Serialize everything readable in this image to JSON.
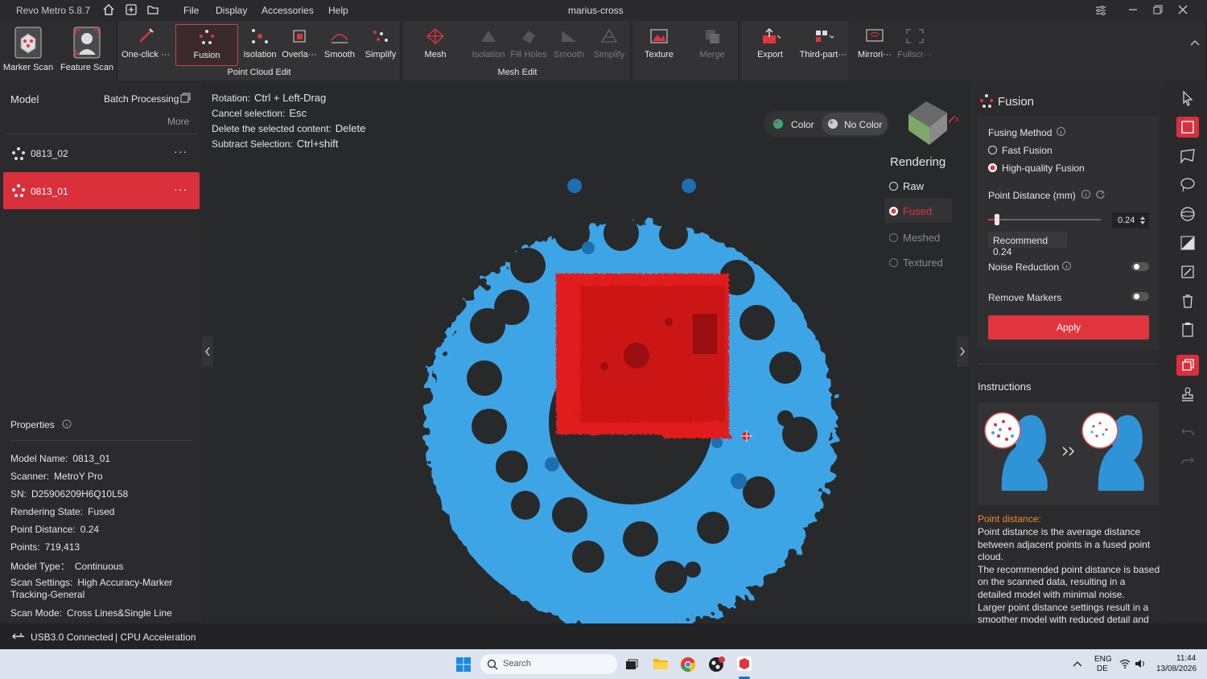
{
  "titlebar": {
    "app": "Revo Metro 5.8.7",
    "menu": [
      "File",
      "Display",
      "Accessories",
      "Help"
    ],
    "project": "marius-cross"
  },
  "ribbon": {
    "scan": [
      "Marker Scan",
      "Feature Scan"
    ],
    "point_cloud": [
      "One-click ···",
      "Fusion",
      "Isolation",
      "Overla···",
      "Smooth",
      "Simplify"
    ],
    "point_cloud_label": "Point Cloud Edit",
    "mesh": [
      "Mesh",
      "Isolation",
      "Fill Holes",
      "Smooth",
      "Simplify"
    ],
    "mesh_label": "Mesh Edit",
    "texture": "Texture",
    "merge": "Merge",
    "export": "Export",
    "thirdparty": "Third-part···",
    "mirror": "Mirrori···",
    "fullscreen": "Fullscr···"
  },
  "left": {
    "title": "Model",
    "batch": "Batch Processing",
    "more": "More",
    "models": [
      "0813_02",
      "0813_01"
    ],
    "properties_title": "Properties",
    "properties": [
      {
        "k": "Model Name:",
        "v": "0813_01"
      },
      {
        "k": "Scanner:",
        "v": "MetroY Pro"
      },
      {
        "k": "SN:",
        "v": "D25906209H6Q10L58"
      },
      {
        "k": "Rendering State:",
        "v": "Fused"
      },
      {
        "k": "Point Distance:",
        "v": "0.24"
      },
      {
        "k": "Points:",
        "v": "719,413"
      },
      {
        "k": "Model Type：",
        "v": "Continuous"
      },
      {
        "k": "Scan Settings:",
        "v": "High Accuracy-Marker"
      },
      {
        "k": "",
        "v": "Tracking-General"
      },
      {
        "k": "Scan Mode:",
        "v": "Cross Lines&Single Line"
      }
    ]
  },
  "viewport": {
    "hints": [
      {
        "k": "Rotation:",
        "v": "Ctrl + Left-Drag"
      },
      {
        "k": "Cancel selection:",
        "v": "Esc"
      },
      {
        "k": "Delete the selected content:",
        "v": "Delete"
      },
      {
        "k": "Subtract Selection:",
        "v": "Ctrl+shift"
      }
    ],
    "color": "Color",
    "nocolor": "No Color",
    "rendering_title": "Rendering",
    "rendering": [
      "Raw",
      "Fused",
      "Meshed",
      "Textured"
    ],
    "axis_x": "x"
  },
  "fusion": {
    "title": "Fusion",
    "method_label": "Fusing Method",
    "methods": [
      "Fast Fusion",
      "High-quality Fusion"
    ],
    "pd_label": "Point Distance (mm)",
    "pd_value": "0.24",
    "slider_fraction": 0.08,
    "recommend": "Recommend 0.24",
    "noise": "Noise Reduction",
    "markers": "Remove Markers",
    "apply": "Apply",
    "instructions": "Instructions",
    "info_title": "Point distance:",
    "info": [
      "Point distance is the average distance",
      "between adjacent points in a fused point",
      "cloud.",
      "The recommended point distance is based",
      "on the scanned data, resulting in a",
      "detailed model with minimal noise.",
      "Larger point distance settings result in a",
      "smoother model with reduced detail and"
    ]
  },
  "status": {
    "usb": "USB3.0 Connected",
    "cpu": "| CPU Acceleration"
  },
  "taskbar": {
    "search": "Search",
    "lang1": "ENG",
    "lang2": "DE",
    "time": "11:44",
    "date": "13/08/2026"
  },
  "colors": {
    "accent": "#e0343f",
    "cloud": "#3da5e6",
    "part": "#e01a1f"
  }
}
